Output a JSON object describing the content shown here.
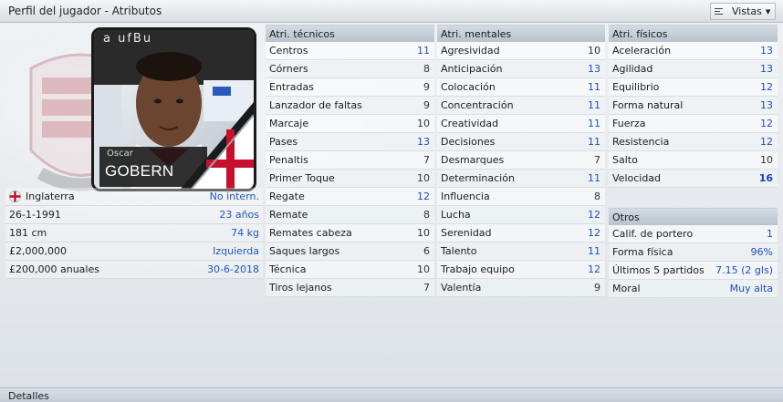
{
  "window": {
    "title": "Perfil del jugador - Atributos",
    "views_label": "Vistas"
  },
  "player": {
    "first_name": "Oscar",
    "last_name": "GOBERN",
    "photo_sponsor_text": "a ufBu"
  },
  "info": [
    {
      "label": "Inglaterra",
      "value": "No intern.",
      "icon": "england-flag-icon"
    },
    {
      "label": "26-1-1991",
      "value": "23 años"
    },
    {
      "label": "181 cm",
      "value": "74 kg"
    },
    {
      "label": "£2,000,000",
      "value": "Izquierda"
    },
    {
      "label": "£200,000 anuales",
      "value": "30-6-2018"
    }
  ],
  "technical": {
    "header": "Atri. técnicos",
    "rows": [
      {
        "label": "Centros",
        "value": "11",
        "style": "blue"
      },
      {
        "label": "Córners",
        "value": "8",
        "style": "plain"
      },
      {
        "label": "Entradas",
        "value": "9",
        "style": "plain"
      },
      {
        "label": "Lanzador de faltas",
        "value": "9",
        "style": "plain"
      },
      {
        "label": "Marcaje",
        "value": "10",
        "style": "plain"
      },
      {
        "label": "Pases",
        "value": "13",
        "style": "blue"
      },
      {
        "label": "Penaltis",
        "value": "7",
        "style": "plain"
      },
      {
        "label": "Primer Toque",
        "value": "10",
        "style": "plain"
      },
      {
        "label": "Regate",
        "value": "12",
        "style": "blue"
      },
      {
        "label": "Remate",
        "value": "8",
        "style": "plain"
      },
      {
        "label": "Remates cabeza",
        "value": "10",
        "style": "plain"
      },
      {
        "label": "Saques largos",
        "value": "6",
        "style": "plain"
      },
      {
        "label": "Técnica",
        "value": "10",
        "style": "plain"
      },
      {
        "label": "Tiros lejanos",
        "value": "7",
        "style": "plain"
      }
    ]
  },
  "mental": {
    "header": "Atri. mentales",
    "rows": [
      {
        "label": "Agresividad",
        "value": "10",
        "style": "plain"
      },
      {
        "label": "Anticipación",
        "value": "13",
        "style": "blue"
      },
      {
        "label": "Colocación",
        "value": "11",
        "style": "blue"
      },
      {
        "label": "Concentración",
        "value": "11",
        "style": "blue"
      },
      {
        "label": "Creatividad",
        "value": "11",
        "style": "blue"
      },
      {
        "label": "Decisiones",
        "value": "11",
        "style": "blue"
      },
      {
        "label": "Desmarques",
        "value": "7",
        "style": "plain"
      },
      {
        "label": "Determinación",
        "value": "11",
        "style": "blue"
      },
      {
        "label": "Influencia",
        "value": "8",
        "style": "plain"
      },
      {
        "label": "Lucha",
        "value": "12",
        "style": "blue"
      },
      {
        "label": "Serenidad",
        "value": "12",
        "style": "blue"
      },
      {
        "label": "Talento",
        "value": "11",
        "style": "blue"
      },
      {
        "label": "Trabajo equipo",
        "value": "12",
        "style": "blue"
      },
      {
        "label": "Valentía",
        "value": "9",
        "style": "plain"
      }
    ]
  },
  "physical": {
    "header": "Atri. físicos",
    "rows": [
      {
        "label": "Aceleración",
        "value": "13",
        "style": "blue"
      },
      {
        "label": "Agilidad",
        "value": "13",
        "style": "blue"
      },
      {
        "label": "Equilibrio",
        "value": "12",
        "style": "blue"
      },
      {
        "label": "Forma natural",
        "value": "13",
        "style": "blue"
      },
      {
        "label": "Fuerza",
        "value": "12",
        "style": "blue"
      },
      {
        "label": "Resistencia",
        "value": "12",
        "style": "blue"
      },
      {
        "label": "Salto",
        "value": "10",
        "style": "plain"
      },
      {
        "label": "Velocidad",
        "value": "16",
        "style": "hi"
      }
    ]
  },
  "others": {
    "header": "Otros",
    "rows": [
      {
        "label": "Calif. de portero",
        "value": "1",
        "style": "blue"
      },
      {
        "label": "Forma física",
        "value": "96%",
        "style": "blue"
      },
      {
        "label": "Últimos 5 partidos",
        "value": "7.15 (2 gls)",
        "style": "blue"
      },
      {
        "label": "Moral",
        "value": "Muy alta",
        "style": "blue"
      }
    ]
  },
  "footer": {
    "label": "Detalles"
  },
  "colors": {
    "value_blue": "#1f4fb8",
    "header_bg": "#c3ccd5",
    "accent_red": "#c8102e"
  }
}
